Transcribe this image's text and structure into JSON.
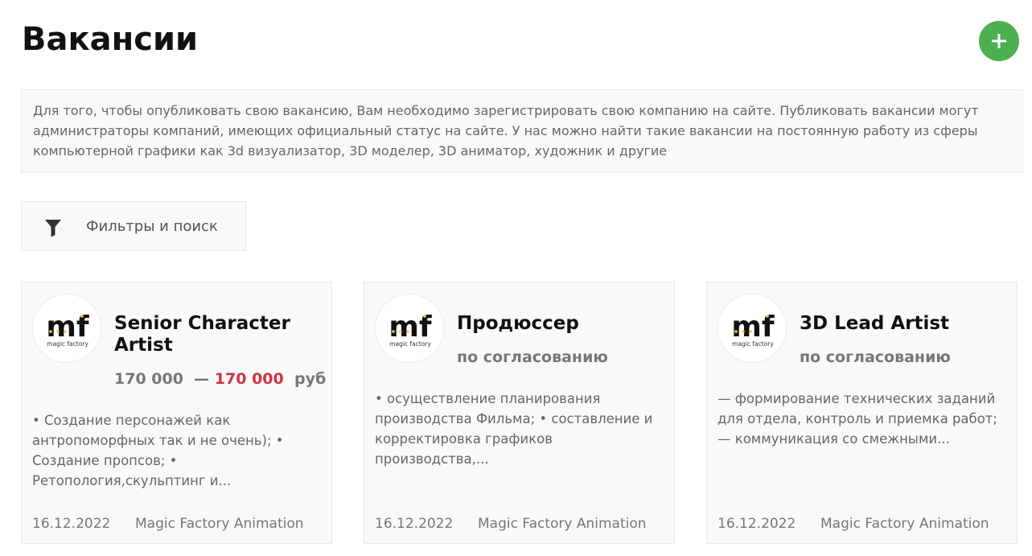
{
  "page": {
    "title": "Вакансии",
    "add_button_label": "+",
    "info_text": "Для того, чтобы опубликовать свою вакансию, Вам необходимо зарегистрировать свою компанию на сайте. Публиковать вакансии могут администраторы компаний, имеющих официальный статус на сайте. У нас можно найти такие вакансии на постоянную работу из сферы компьютерной графики как 3d визуализатор, 3D моделер, 3D аниматор, художник и другие",
    "filter_label": "Фильтры и поиск"
  },
  "colors": {
    "accent_green": "#4caf50",
    "salary_red": "#d03344"
  },
  "icons": {
    "add": "plus-icon",
    "filter": "funnel-icon",
    "company_logo": "magic-factory-logo"
  },
  "logo": {
    "mark": "mf",
    "tagline": "magic factory"
  },
  "vacancies": [
    {
      "title": "Senior Character Artist",
      "salary_min": "170 000",
      "salary_separator": "—",
      "salary_max": "170 000",
      "currency": "руб",
      "description": "• Создание персонажей как антропоморфных так и не очень); • Создание пропсов; • Ретопология,скульптинг и...",
      "date": "16.12.2022",
      "company": "Magic Factory Animation"
    },
    {
      "title": "Продюссер",
      "salary_text": "по согласованию",
      "description": "• осуществление планирования производства Фильма; • составление и корректировка графиков производства,...",
      "date": "16.12.2022",
      "company": "Magic Factory Animation"
    },
    {
      "title": "3D Lead Artist",
      "salary_text": "по согласованию",
      "description": "— формирование технических заданий для отдела, контроль и приемка работ; — коммуникация со смежными...",
      "date": "16.12.2022",
      "company": "Magic Factory Animation"
    }
  ]
}
